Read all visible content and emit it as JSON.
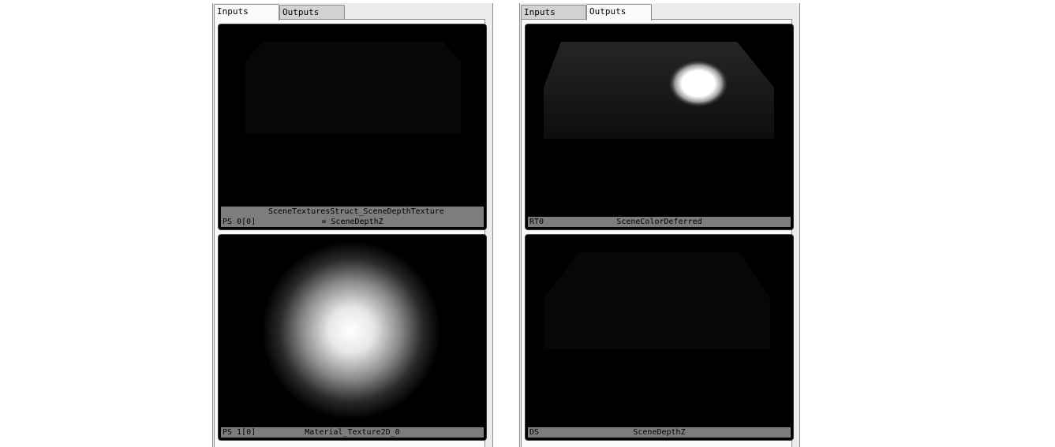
{
  "left_panel": {
    "tabs": [
      {
        "label": "Inputs",
        "active": true
      },
      {
        "label": "Outputs",
        "active": false
      }
    ],
    "thumbnails": [
      {
        "slot": "PS 0[0]",
        "name": "SceneTexturesStruct_SceneDepthTexture = SceneDepthZ"
      },
      {
        "slot": "PS 1[0]",
        "name": "Material_Texture2D_0"
      }
    ]
  },
  "right_panel": {
    "tabs": [
      {
        "label": "Inputs",
        "active": false
      },
      {
        "label": "Outputs",
        "active": true
      }
    ],
    "thumbnails": [
      {
        "slot": "RT0",
        "name": "SceneColorDeferred"
      },
      {
        "slot": "DS",
        "name": "SceneDepthZ"
      }
    ]
  }
}
